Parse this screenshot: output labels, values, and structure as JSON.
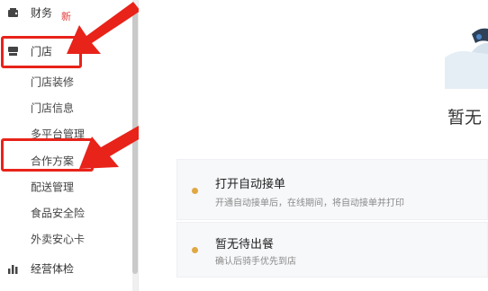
{
  "sidebar": {
    "items": [
      {
        "label": "财务",
        "badge": "新",
        "icon": "wallet-icon"
      },
      {
        "label": "门店",
        "icon": "store-icon"
      },
      {
        "label": "门店装修"
      },
      {
        "label": "门店信息"
      },
      {
        "label": "多平台管理"
      },
      {
        "label": "合作方案"
      },
      {
        "label": "配送管理"
      },
      {
        "label": "食品安全险"
      },
      {
        "label": "外卖安心卡"
      },
      {
        "label": "经营体检",
        "icon": "bar-chart-icon"
      }
    ]
  },
  "main": {
    "empty_text": "暂无",
    "cards": [
      {
        "title": "打开自动接单",
        "desc": "开通自动接单后，在线期间，将自动接单并打印"
      },
      {
        "title": "暂无待出餐",
        "desc": "确认后骑手优先到店"
      }
    ]
  },
  "colors": {
    "highlight": "#e8231a",
    "dot": "#e0a843",
    "badge": "#e53935"
  }
}
